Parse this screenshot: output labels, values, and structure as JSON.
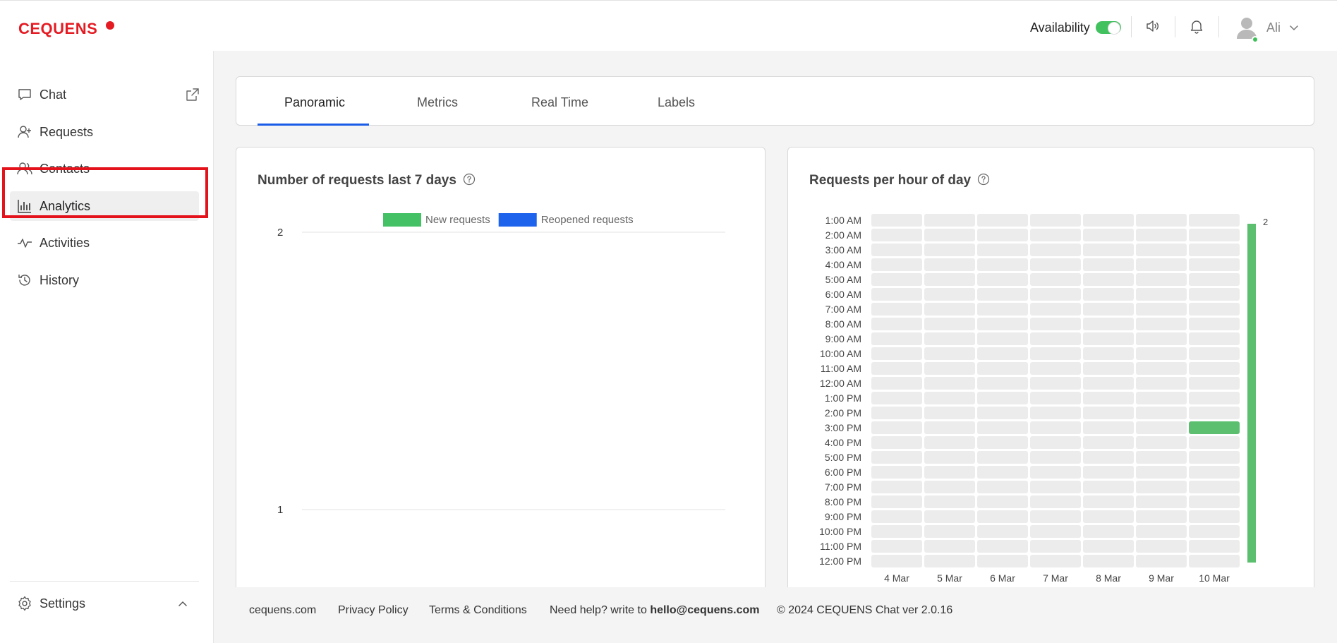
{
  "header": {
    "logo": "CEQUENS",
    "availability_label": "Availability",
    "availability_on": true,
    "user_name": "Ali",
    "icons": [
      "speaker-icon",
      "bell-icon",
      "avatar-icon",
      "chevron-down-icon"
    ],
    "accent_color": "#e41b23"
  },
  "sidebar": {
    "items": [
      {
        "label": "Chat",
        "icon": "chat-bubble-icon"
      },
      {
        "label": "Requests",
        "icon": "add-user-icon"
      },
      {
        "label": "Contacts",
        "icon": "users-icon"
      },
      {
        "label": "Analytics",
        "icon": "bar-chart-icon",
        "active": true
      },
      {
        "label": "Activities",
        "icon": "activity-icon"
      },
      {
        "label": "History",
        "icon": "history-icon"
      }
    ],
    "settings_label": "Settings"
  },
  "tabs": [
    {
      "label": "Panoramic",
      "active": true
    },
    {
      "label": "Metrics"
    },
    {
      "label": "Real Time"
    },
    {
      "label": "Labels"
    }
  ],
  "cards": {
    "requests_7_days": {
      "title": "Number of requests last 7 days"
    },
    "requests_per_hour": {
      "title": "Requests per hour of day"
    }
  },
  "chart_data": [
    {
      "type": "bar",
      "title": "Number of requests last 7 days",
      "series": [
        {
          "name": "New requests",
          "color": "#44c165",
          "values": []
        },
        {
          "name": "Reopened requests",
          "color": "#1e63ec",
          "values": []
        }
      ],
      "y_ticks": [
        "2",
        "1"
      ],
      "legend": "top",
      "grid": true
    },
    {
      "type": "heatmap",
      "title": "Requests per hour of day",
      "hours": [
        "1:00 AM",
        "2:00 AM",
        "3:00 AM",
        "4:00 AM",
        "5:00 AM",
        "6:00 AM",
        "7:00 AM",
        "8:00 AM",
        "9:00 AM",
        "10:00 AM",
        "11:00 AM",
        "12:00 AM",
        "1:00 PM",
        "2:00 PM",
        "3:00 PM",
        "4:00 PM",
        "5:00 PM",
        "6:00 PM",
        "7:00 PM",
        "8:00 PM",
        "9:00 PM",
        "10:00 PM",
        "11:00 PM",
        "12:00 PM"
      ],
      "days": [
        "4 Mar",
        "5 Mar",
        "6 Mar",
        "7 Mar",
        "8 Mar",
        "9 Mar",
        "10 Mar"
      ],
      "cells": [
        {
          "day": "10 Mar",
          "hour": "3:00 PM",
          "value": 2
        }
      ],
      "scale_max": 2,
      "scale_label": "2",
      "empty_color": "#ececec",
      "fill_color": "#5cbf6f"
    }
  ],
  "footer": {
    "site": "cequens.com",
    "privacy": "Privacy Policy",
    "terms": "Terms & Conditions",
    "help_prefix": "Need help? write to",
    "help_email": "hello@cequens.com",
    "copyright": "© 2024 CEQUENS Chat ver 2.0.16"
  }
}
